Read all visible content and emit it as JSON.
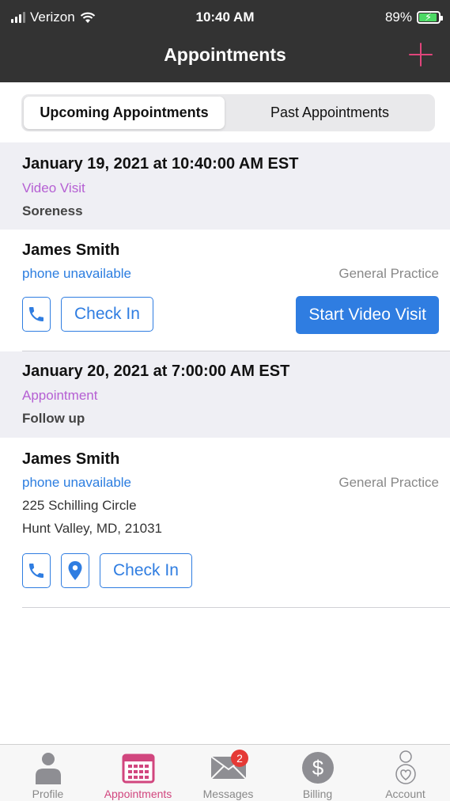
{
  "status_bar": {
    "carrier": "Verizon",
    "time": "10:40 AM",
    "battery": "89%"
  },
  "nav": {
    "title": "Appointments",
    "add_icon": "plus-icon"
  },
  "segments": {
    "upcoming": "Upcoming Appointments",
    "past": "Past Appointments",
    "selected": "upcoming"
  },
  "appointments": [
    {
      "datetime": "January 19, 2021 at 10:40:00 AM EST",
      "type": "Video Visit",
      "reason": "Soreness",
      "provider": "James Smith",
      "phone": "phone unavailable",
      "specialty": "General Practice",
      "checkin_label": "Check In",
      "video_label": "Start Video Visit"
    },
    {
      "datetime": "January 20, 2021 at 7:00:00 AM EST",
      "type": "Appointment",
      "reason": "Follow up",
      "provider": "James Smith",
      "phone": "phone unavailable",
      "specialty": "General Practice",
      "address_line1": "225 Schilling Circle",
      "address_line2": "Hunt Valley, MD, 21031",
      "checkin_label": "Check In"
    }
  ],
  "tabbar": {
    "items": [
      {
        "label": "Profile",
        "icon": "person-icon"
      },
      {
        "label": "Appointments",
        "icon": "calendar-icon"
      },
      {
        "label": "Messages",
        "icon": "envelope-icon",
        "badge": "2"
      },
      {
        "label": "Billing",
        "icon": "dollar-icon"
      },
      {
        "label": "Account",
        "icon": "account-icon"
      }
    ],
    "active": "Appointments"
  },
  "colors": {
    "accent": "#2f7de1",
    "brand": "#d1467e",
    "type_purple": "#b55fd3",
    "header_bg": "#333333"
  }
}
